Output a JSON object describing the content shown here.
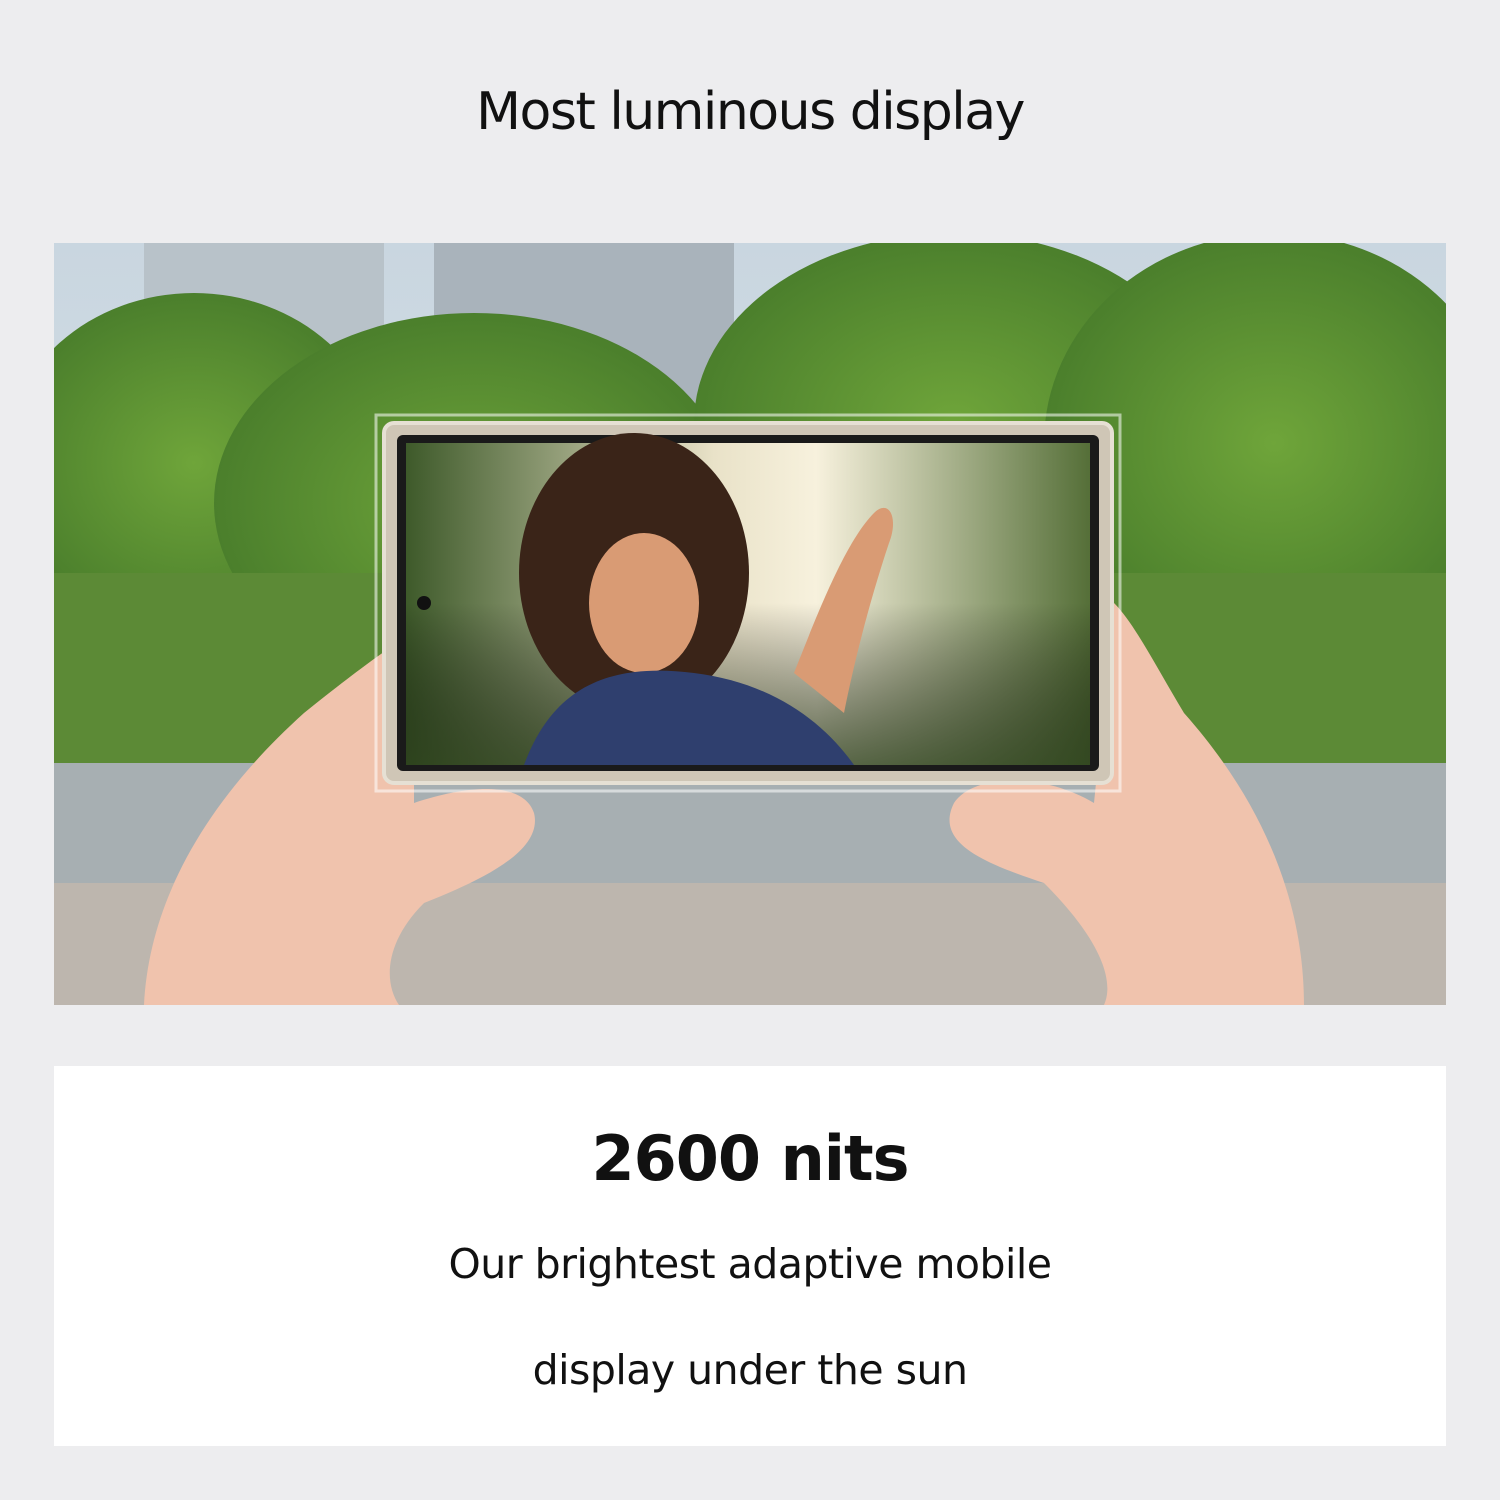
{
  "headline": "Most luminous display",
  "stat": "2600 nits",
  "description_lines": [
    "Our brightest adaptive mobile",
    "display under the sun"
  ],
  "colors": {
    "page_background": "#ededef",
    "card_background": "#ffffff",
    "text": "#111111"
  },
  "image": {
    "subject": "hands-holding-phone-photo"
  }
}
